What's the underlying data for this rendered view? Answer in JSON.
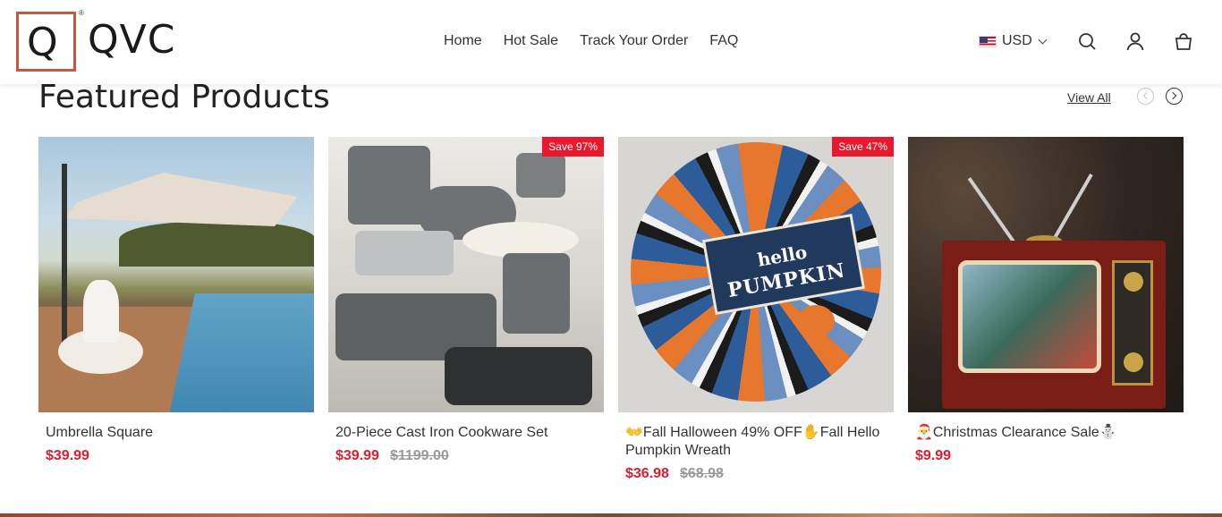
{
  "brand": {
    "logo_letter": "Q",
    "logo_word": "QVC",
    "registered": "®"
  },
  "nav": [
    "Home",
    "Hot Sale",
    "Track Your Order",
    "FAQ"
  ],
  "currency": {
    "label": "USD",
    "flag": "us-flag-icon"
  },
  "header_icons": [
    "search-icon",
    "user-icon",
    "bag-icon"
  ],
  "section": {
    "title": "Featured Products",
    "view_all": "View All"
  },
  "products": [
    {
      "name": "Umbrella Square",
      "price": "$39.99",
      "old_price": "",
      "badge": ""
    },
    {
      "name": "20-Piece Cast Iron Cookware Set",
      "price": "$39.99",
      "old_price": "$1199.00",
      "badge": "Save 97%"
    },
    {
      "name": "👐Fall Halloween 49% OFF✋Fall Hello Pumpkin Wreath",
      "price": "$36.98",
      "old_price": "$68.98",
      "badge": "Save 47%"
    },
    {
      "name": "🎅Christmas Clearance Sale⛄",
      "price": "$9.99",
      "old_price": "",
      "badge": ""
    }
  ],
  "images": {
    "wreath_text_1": "hello",
    "wreath_text_2": "PUMPKIN"
  },
  "colors": {
    "sale_red": "#e8192c",
    "logo_border": "#c8573e"
  }
}
